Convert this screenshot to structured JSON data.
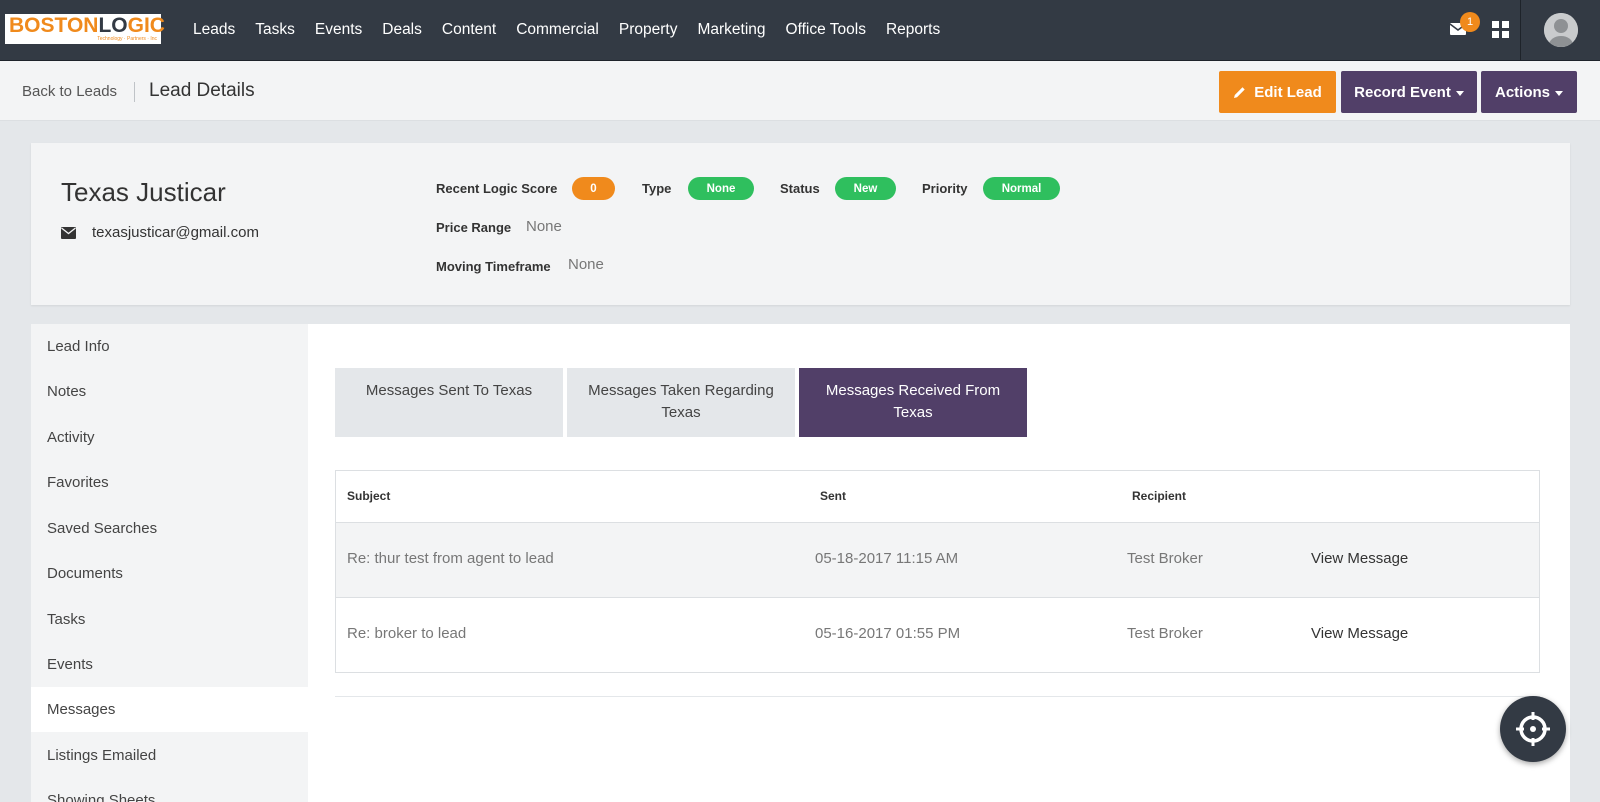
{
  "brand": {
    "logo_left": "BOSTON",
    "logo_o": "LO",
    "logo_right": "GIC",
    "logo_tagline": "Technology · Partners · Inc"
  },
  "nav": {
    "items": [
      {
        "label": "Leads"
      },
      {
        "label": "Tasks"
      },
      {
        "label": "Events"
      },
      {
        "label": "Deals"
      },
      {
        "label": "Content"
      },
      {
        "label": "Commercial"
      },
      {
        "label": "Property"
      },
      {
        "label": "Marketing"
      },
      {
        "label": "Office Tools"
      },
      {
        "label": "Reports"
      }
    ],
    "mail_count": "1"
  },
  "header": {
    "back_label": "Back to Leads",
    "title": "Lead Details",
    "edit_label": "Edit Lead",
    "record_label": "Record Event",
    "actions_label": "Actions"
  },
  "lead": {
    "name": "Texas Justicar",
    "email": "texasjusticar@gmail.com",
    "score_label": "Recent Logic Score",
    "score_value": "0",
    "type_label": "Type",
    "type_value": "None",
    "status_label": "Status",
    "status_value": "New",
    "priority_label": "Priority",
    "priority_value": "Normal",
    "price_label": "Price Range",
    "price_value": "None",
    "timeframe_label": "Moving Timeframe",
    "timeframe_value": "None"
  },
  "sidebar": {
    "items": [
      {
        "label": "Lead Info"
      },
      {
        "label": "Notes"
      },
      {
        "label": "Activity"
      },
      {
        "label": "Favorites"
      },
      {
        "label": "Saved Searches"
      },
      {
        "label": "Documents"
      },
      {
        "label": "Tasks"
      },
      {
        "label": "Events"
      },
      {
        "label": "Messages"
      },
      {
        "label": "Listings Emailed"
      },
      {
        "label": "Showing Sheets"
      }
    ],
    "active": "Messages"
  },
  "tabs": [
    {
      "label": "Messages Sent To Texas"
    },
    {
      "label": "Messages Taken Regarding Texas"
    },
    {
      "label": "Messages Received From Texas"
    }
  ],
  "table": {
    "headers": {
      "subject": "Subject",
      "sent": "Sent",
      "recipient": "Recipient"
    },
    "rows": [
      {
        "subject": "Re: thur test from agent to lead",
        "sent": "05-18-2017 11:15 AM",
        "recipient": "Test Broker",
        "action": "View Message"
      },
      {
        "subject": "Re: broker to lead",
        "sent": "05-16-2017 01:55 PM",
        "recipient": "Test Broker",
        "action": "View Message"
      }
    ]
  },
  "colors": {
    "nav_bg": "#333a44",
    "accent_orange": "#f08a1c",
    "accent_purple": "#513f68",
    "pill_green": "#2fbf5e"
  },
  "icons": [
    "envelope-icon",
    "grid-icon",
    "avatar-icon",
    "pencil-icon",
    "crosshair-icon"
  ]
}
